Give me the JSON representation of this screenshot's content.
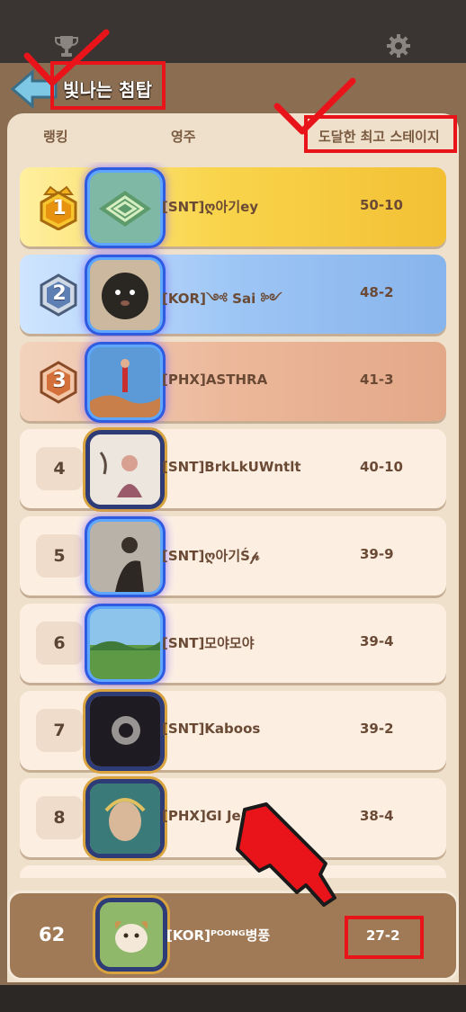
{
  "header": {
    "title": "빛나는 첨탑",
    "trophy_icon": "trophy-icon",
    "settings_icon": "gear-icon",
    "back_icon": "back-arrow-icon"
  },
  "columns": {
    "rank": "랭킹",
    "lord": "영주",
    "stage": "도달한 최고 스테이지"
  },
  "rows": [
    {
      "rank": "1",
      "name": "[SNT]ღ아기ey",
      "stage": "50-10"
    },
    {
      "rank": "2",
      "name": "[KOR]༺ Sai ༻",
      "stage": "48-2"
    },
    {
      "rank": "3",
      "name": "[PHX]ASTHRA",
      "stage": "41-3"
    },
    {
      "rank": "4",
      "name": "[SNT]BrkLkUWntlt",
      "stage": "40-10"
    },
    {
      "rank": "5",
      "name": "[SNT]ღ아기Ś𝓅",
      "stage": "39-9"
    },
    {
      "rank": "6",
      "name": "[SNT]모야모야",
      "stage": "39-4"
    },
    {
      "rank": "7",
      "name": "[SNT]Kaboos",
      "stage": "39-2"
    },
    {
      "rank": "8",
      "name": "[PHX]GI Jen",
      "stage": "38-4"
    }
  ],
  "me": {
    "rank": "62",
    "name": "[KOR]ᴾᴼᴼᴺᴳ병풍",
    "stage": "27-2"
  },
  "colors": {
    "gold": "#f3c034",
    "silver": "#87b4ec",
    "bronze": "#e3a888",
    "highlight": "#e8141a"
  }
}
